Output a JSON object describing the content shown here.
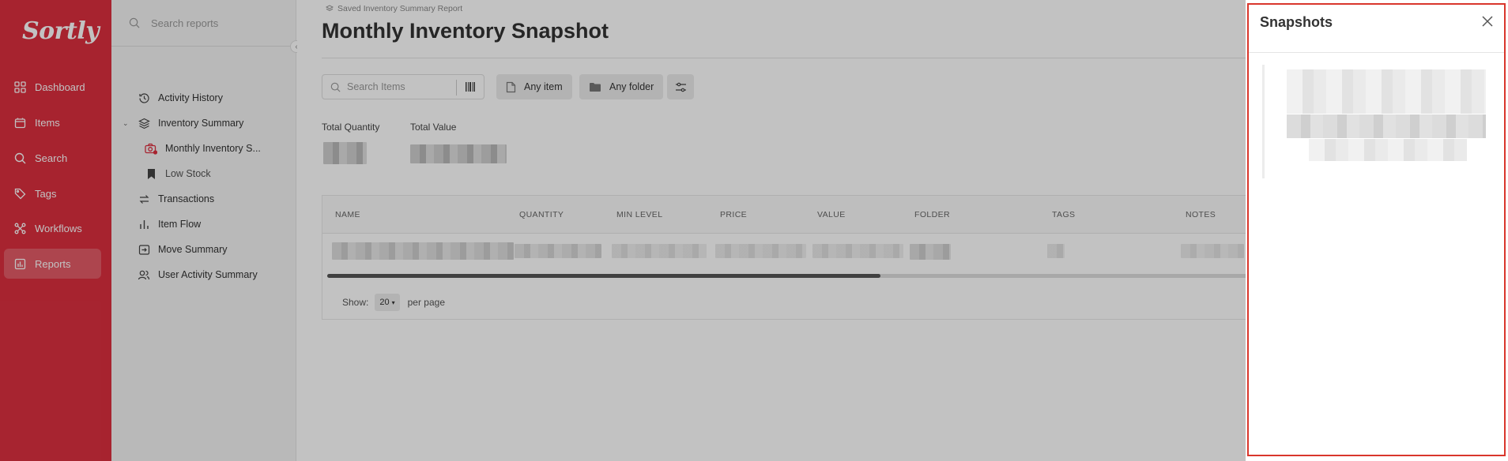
{
  "app": {
    "logo": "Sortly"
  },
  "nav": {
    "items": [
      {
        "label": "Dashboard",
        "icon": "dashboard-icon"
      },
      {
        "label": "Items",
        "icon": "items-icon"
      },
      {
        "label": "Search",
        "icon": "search-icon"
      },
      {
        "label": "Tags",
        "icon": "tag-icon"
      },
      {
        "label": "Workflows",
        "icon": "workflows-icon"
      },
      {
        "label": "Reports",
        "icon": "reports-icon",
        "active": true
      }
    ]
  },
  "sidebar": {
    "search_placeholder": "Search reports",
    "items": [
      {
        "label": "Activity History",
        "icon": "history-icon"
      },
      {
        "label": "Inventory Summary",
        "icon": "layers-icon",
        "expanded": true
      },
      {
        "label": "Monthly Inventory S...",
        "icon": "camera-icon"
      },
      {
        "label": "Low Stock",
        "icon": "bookmark-icon"
      },
      {
        "label": "Transactions",
        "icon": "transactions-icon"
      },
      {
        "label": "Item Flow",
        "icon": "bar-chart-icon"
      },
      {
        "label": "Move Summary",
        "icon": "move-icon"
      },
      {
        "label": "User Activity Summary",
        "icon": "users-icon"
      }
    ]
  },
  "main": {
    "breadcrumb": "Saved Inventory Summary Report",
    "title": "Monthly Inventory Snapshot",
    "search_placeholder": "Search Items",
    "filters": {
      "item": "Any item",
      "folder": "Any folder"
    },
    "stats": {
      "total_quantity_label": "Total Quantity",
      "total_value_label": "Total Value"
    },
    "table": {
      "columns": [
        "NAME",
        "QUANTITY",
        "MIN LEVEL",
        "PRICE",
        "VALUE",
        "FOLDER",
        "TAGS",
        "NOTES"
      ]
    },
    "pagination": {
      "show_label": "Show:",
      "per_page_value": "20",
      "per_page_label": "per page"
    }
  },
  "panel": {
    "title": "Snapshots"
  },
  "colors": {
    "brand": "#dc2f3f",
    "highlight": "#d9362c"
  }
}
